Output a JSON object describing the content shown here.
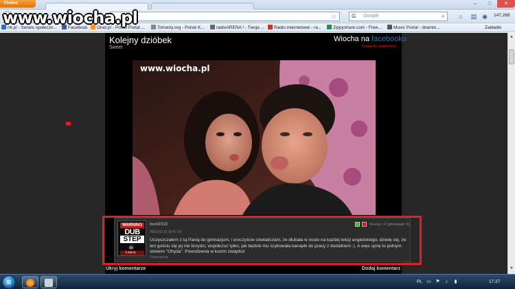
{
  "browser": {
    "app_button_label": "Firefox",
    "search_placeholder": "Google",
    "counter_text": "147,268",
    "bookmarks_overflow": "Zakładki"
  },
  "bookmarks": [
    {
      "label": "nk.pl - Serwis społeczn...",
      "color": "#2b6cc4"
    },
    {
      "label": "Facebook",
      "color": "#3b5998"
    },
    {
      "label": "Onet.pl - Polski Portal ...",
      "color": "#f7941d"
    },
    {
      "label": "Torrenty.org - Polski K...",
      "color": "#888888"
    },
    {
      "label": "radioARENA ! - Twoja ...",
      "color": "#666666"
    },
    {
      "label": "Radio internetowe - ra...",
      "color": "#c0392b"
    },
    {
      "label": "Zippyshare.com - Free...",
      "color": "#2e8b57"
    },
    {
      "label": "Music Portal - downlo...",
      "color": "#555555"
    }
  ],
  "site": {
    "logo": "www.wiocha.pl",
    "facebook_prefix": "Wiocha na",
    "facebook_word": "facebooku",
    "add_to_favorites": "Dodaj do ulubionych"
  },
  "post": {
    "title": "Kolejny dzióbek",
    "subtitle": "Sweet",
    "watermark": "www.wiocha.pl"
  },
  "comment": {
    "avatar": {
      "warning": "WARNING",
      "line1": "DUB",
      "line2": "STEP",
      "rank": "Łowca"
    },
    "username": "buni1515",
    "date": "2012-01-13 20:47:16",
    "rating": "Ocena: -6 (głosowań: 6)",
    "text": "Uczęszczałem z tą Panią do gimnazjum, i uroczyście oświadczam, że dłubała w nosie na każdej lekcji angielskiego, dziwię się, że ten gościu się jej nie brzydzi, współczuć tylko, jak będzie mu szykowała kanapki do pracy z dodatkiem :). A więc ujmę to jednym słowem \"Ohyda\". Powodzenia w kozim związku!",
    "reply": "Odpowiedz"
  },
  "footer": {
    "left": "Ukryj komentarze",
    "right": "Dodaj komentarz"
  },
  "taskbar": {
    "language": "PL",
    "time": "17:27"
  },
  "colors": {
    "highlight_frame": "#e01e24",
    "page_background": "#262626",
    "facebook_blue": "#3b6fb3"
  }
}
